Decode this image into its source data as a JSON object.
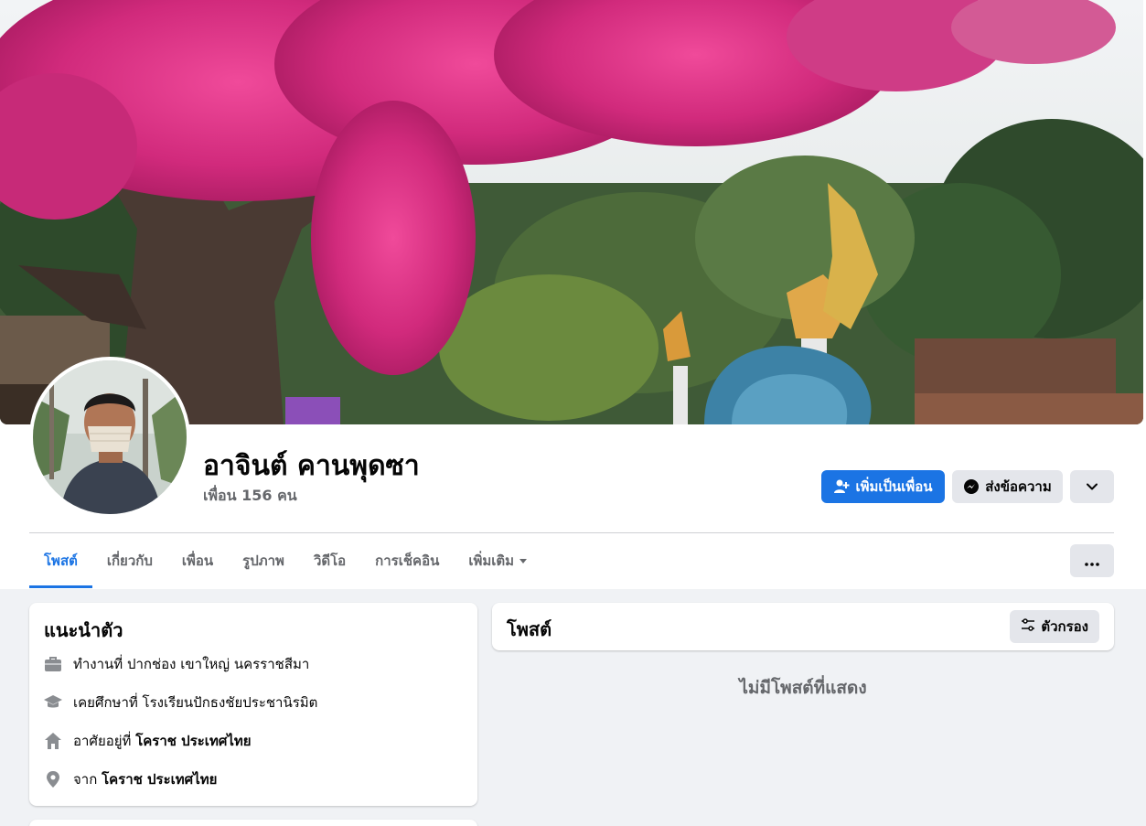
{
  "profile": {
    "name": "อาจินต์ คานพุดซา",
    "friends": "เพื่อน 156 คน"
  },
  "actions": {
    "add_friend": "เพิ่มเป็นเพื่อน",
    "message": "ส่งข้อความ"
  },
  "tabs": [
    {
      "label": "โพสต์"
    },
    {
      "label": "เกี่ยวกับ"
    },
    {
      "label": "เพื่อน"
    },
    {
      "label": "รูปภาพ"
    },
    {
      "label": "วิดีโอ"
    },
    {
      "label": "การเช็คอิน"
    },
    {
      "label": "เพิ่มเติม"
    }
  ],
  "intro": {
    "title": "แนะนำตัว",
    "items": [
      {
        "icon": "briefcase-icon",
        "text": "ทำงานที่ ปากช่อง เขาใหญ่ นครราชสีมา",
        "bold": ""
      },
      {
        "icon": "graduation-cap-icon",
        "text": "เคยศึกษาที่ โรงเรียนปักธงชัยประชานิรมิต",
        "bold": ""
      },
      {
        "icon": "home-icon",
        "text": "อาศัยอยู่ที่ ",
        "bold": "โคราช ประเทศไทย"
      },
      {
        "icon": "location-pin-icon",
        "text": "จาก ",
        "bold": "โคราช ประเทศไทย"
      }
    ]
  },
  "posts": {
    "title": "โพสต์",
    "filter": "ตัวกรอง",
    "empty": "ไม่มีโพสต์ที่แสดง"
  },
  "colors": {
    "accent": "#1b74e4",
    "secondary_text": "#65676b",
    "background": "#f0f2f5"
  }
}
